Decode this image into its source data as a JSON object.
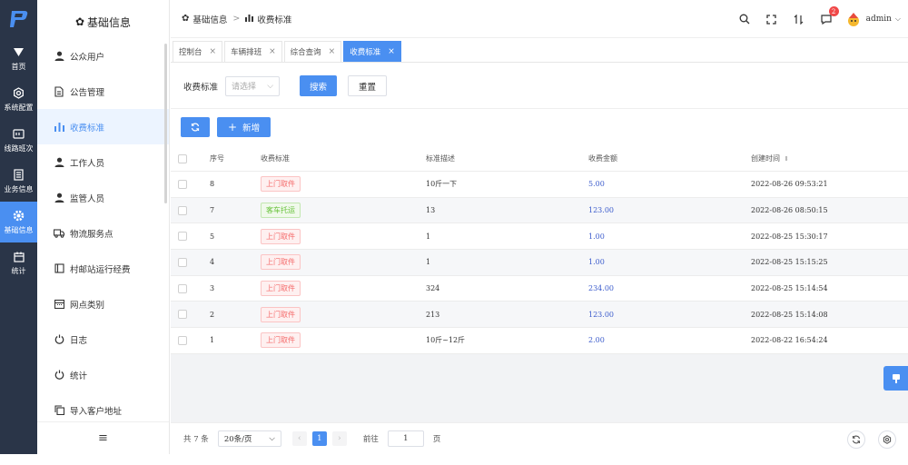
{
  "rail": {
    "items": [
      {
        "label": "首页",
        "icon": "home-icon"
      },
      {
        "label": "系统配置",
        "icon": "settings-icon"
      },
      {
        "label": "线路班次",
        "icon": "route-icon"
      },
      {
        "label": "业务信息",
        "icon": "document-icon"
      },
      {
        "label": "基础信息",
        "icon": "gear-icon",
        "active": true
      },
      {
        "label": "统计",
        "icon": "calendar-icon"
      }
    ]
  },
  "sidebar": {
    "title": "基础信息",
    "items": [
      {
        "label": "公众用户",
        "icon": "user-icon"
      },
      {
        "label": "公告管理",
        "icon": "file-icon"
      },
      {
        "label": "收费标准",
        "icon": "bar-chart-icon",
        "active": true
      },
      {
        "label": "工作人员",
        "icon": "user-icon"
      },
      {
        "label": "监管人员",
        "icon": "user-icon"
      },
      {
        "label": "物流服务点",
        "icon": "truck-icon"
      },
      {
        "label": "村邮站运行经费",
        "icon": "folder-icon"
      },
      {
        "label": "网点类别",
        "icon": "calendar-icon"
      },
      {
        "label": "日志",
        "icon": "power-icon"
      },
      {
        "label": "统计",
        "icon": "power-icon"
      },
      {
        "label": "导入客户地址",
        "icon": "copy-icon"
      }
    ]
  },
  "header": {
    "breadcrumb_root": "基础信息",
    "breadcrumb_current": "收费标准",
    "notification_count": "2",
    "user_name": "admin"
  },
  "tabs": [
    {
      "label": "控制台"
    },
    {
      "label": "车辆排班"
    },
    {
      "label": "综合查询"
    },
    {
      "label": "收费标准",
      "active": true
    }
  ],
  "search": {
    "label": "收费标准",
    "placeholder": "请选择",
    "search_button": "搜索",
    "reset_button": "重置"
  },
  "toolbar": {
    "add_label": "新增"
  },
  "table": {
    "columns": [
      "序号",
      "收费标准",
      "标准描述",
      "收费金额",
      "创建时间"
    ],
    "rows": [
      {
        "no": "8",
        "type": "上门取件",
        "type_color": "red",
        "desc": "10斤一下",
        "amount": "5.00",
        "time": "2022-08-26 09:53:21"
      },
      {
        "no": "7",
        "type": "客车托运",
        "type_color": "green",
        "desc": "13",
        "amount": "123.00",
        "time": "2022-08-26 08:50:15"
      },
      {
        "no": "5",
        "type": "上门取件",
        "type_color": "red",
        "desc": "1",
        "amount": "1.00",
        "time": "2022-08-25 15:30:17"
      },
      {
        "no": "4",
        "type": "上门取件",
        "type_color": "red",
        "desc": "1",
        "amount": "1.00",
        "time": "2022-08-25 15:15:25"
      },
      {
        "no": "3",
        "type": "上门取件",
        "type_color": "red",
        "desc": "324",
        "amount": "234.00",
        "time": "2022-08-25 15:14:54"
      },
      {
        "no": "2",
        "type": "上门取件",
        "type_color": "red",
        "desc": "213",
        "amount": "123.00",
        "time": "2022-08-25 15:14:08"
      },
      {
        "no": "1",
        "type": "上门取件",
        "type_color": "red",
        "desc": "10斤~12斤",
        "amount": "2.00",
        "time": "2022-08-22 16:54:24"
      }
    ]
  },
  "pagination": {
    "total": "共 7 条",
    "page_size": "20条/页",
    "current_page": "1",
    "goto_label": "前往",
    "goto_value": "1",
    "page_suffix": "页"
  },
  "colors": {
    "accent": "#4a8ff1",
    "rail_bg": "#2a3548",
    "tag_red": "#f56c6c",
    "tag_green": "#67c23a",
    "amount": "#3b5bcc"
  }
}
